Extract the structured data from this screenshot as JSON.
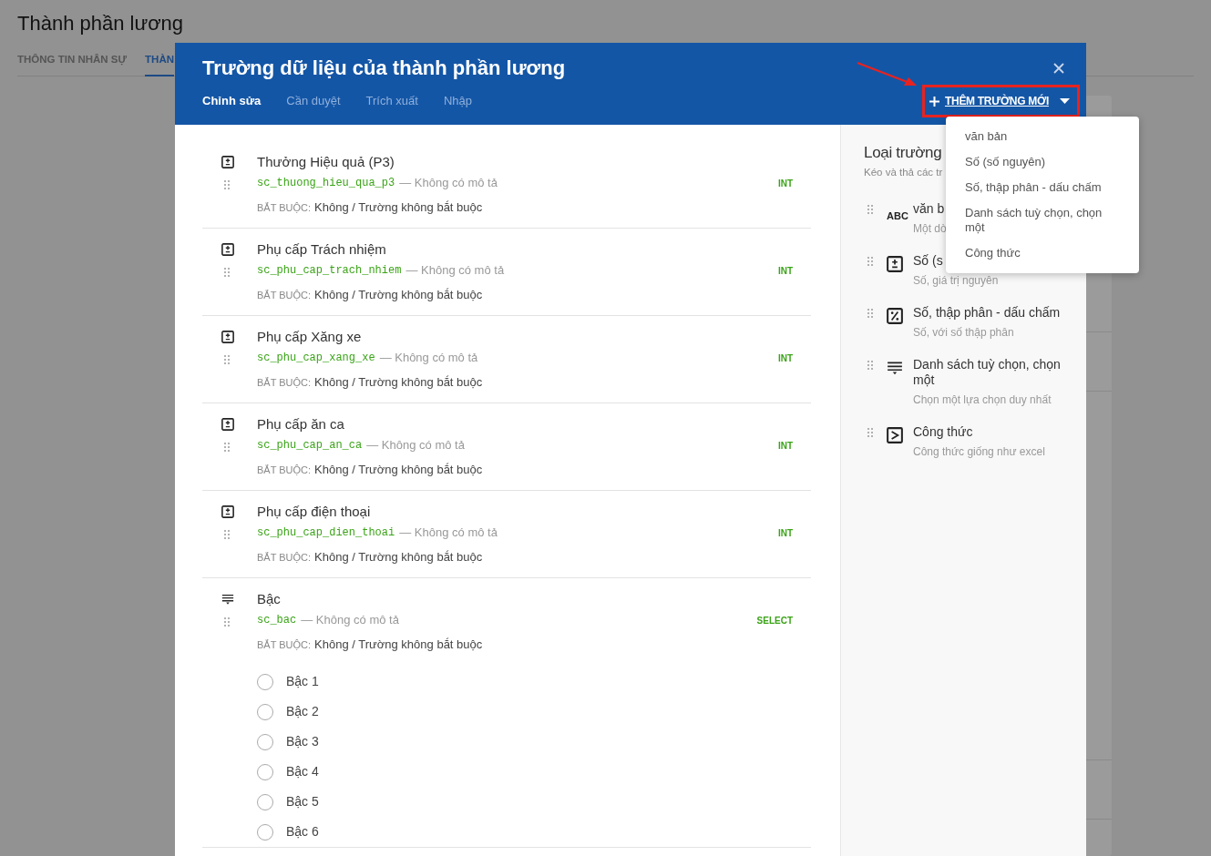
{
  "page": {
    "title": "Thành phần lương",
    "tabs": [
      {
        "label": "THÔNG TIN NHÂN SỰ",
        "selected": false
      },
      {
        "label": "THÀN",
        "selected": true
      }
    ]
  },
  "dialog": {
    "title": "Trường dữ liệu của thành phần lương",
    "tabs": [
      {
        "label": "Chỉnh sửa",
        "selected": true
      },
      {
        "label": "Cần duyệt",
        "selected": false
      },
      {
        "label": "Trích xuất",
        "selected": false
      },
      {
        "label": "Nhập",
        "selected": false
      }
    ],
    "add_button": {
      "label": "THÊM TRƯỜNG MỚI",
      "highlighted": true
    },
    "fields": [
      {
        "kind": "int",
        "name": "Thưởng Hiệu quả (P3)",
        "code": "sc_thuong_hieu_qua_p3",
        "description": "— Không có mô tả",
        "type": "INT",
        "required_label": "BẮT BUỘC:",
        "required_value": "Không / Trường không bắt buộc"
      },
      {
        "kind": "int",
        "name": "Phụ cấp Trách nhiệm",
        "code": "sc_phu_cap_trach_nhiem",
        "description": "— Không có mô tả",
        "type": "INT",
        "required_label": "BẮT BUỘC:",
        "required_value": "Không / Trường không bắt buộc"
      },
      {
        "kind": "int",
        "name": "Phụ cấp Xăng xe",
        "code": "sc_phu_cap_xang_xe",
        "description": "— Không có mô tả",
        "type": "INT",
        "required_label": "BẮT BUỘC:",
        "required_value": "Không / Trường không bắt buộc"
      },
      {
        "kind": "int",
        "name": "Phụ cấp ăn ca",
        "code": "sc_phu_cap_an_ca",
        "description": "— Không có mô tả",
        "type": "INT",
        "required_label": "BẮT BUỘC:",
        "required_value": "Không / Trường không bắt buộc"
      },
      {
        "kind": "int",
        "name": "Phụ cấp điện thoại",
        "code": "sc_phu_cap_dien_thoai",
        "description": "— Không có mô tả",
        "type": "INT",
        "required_label": "BẮT BUỘC:",
        "required_value": "Không / Trường không bắt buộc"
      },
      {
        "kind": "select",
        "name": "Bậc",
        "code": "sc_bac",
        "description": "— Không có mô tả",
        "type": "SELECT",
        "required_label": "BẮT BUỘC:",
        "required_value": "Không / Trường không bắt buộc",
        "options": [
          {
            "label": "Bậc 1",
            "selected": false
          },
          {
            "label": "Bậc 2",
            "selected": false
          },
          {
            "label": "Bậc 3",
            "selected": false
          },
          {
            "label": "Bậc 4",
            "selected": false
          },
          {
            "label": "Bậc 5",
            "selected": false
          },
          {
            "label": "Bậc 6",
            "selected": false
          }
        ]
      }
    ],
    "field_types": {
      "title": "Loại trường",
      "subtitle": "Kéo và thả các tr",
      "items": [
        {
          "kind": "text",
          "icon_text": "ABC",
          "name": "văn b",
          "description": "Một dò"
        },
        {
          "kind": "int",
          "name": "Số (s",
          "description": "Số, giá trị nguyên"
        },
        {
          "kind": "decimal",
          "name": "Số, thập phân - dấu chấm",
          "description": "Số, với số thập phân"
        },
        {
          "kind": "select",
          "name": "Danh sách tuỳ chọn, chọn một",
          "description": "Chọn một lựa chọn duy nhất"
        },
        {
          "kind": "formula",
          "name": "Công thức",
          "description": "Công thức giống như excel"
        }
      ]
    },
    "dropdown": {
      "items": [
        "văn bản",
        "Số (số nguyên)",
        "Số, thập phân - dấu chấm",
        "Danh sách tuỳ chọn, chọn một",
        "Công thức"
      ]
    }
  }
}
